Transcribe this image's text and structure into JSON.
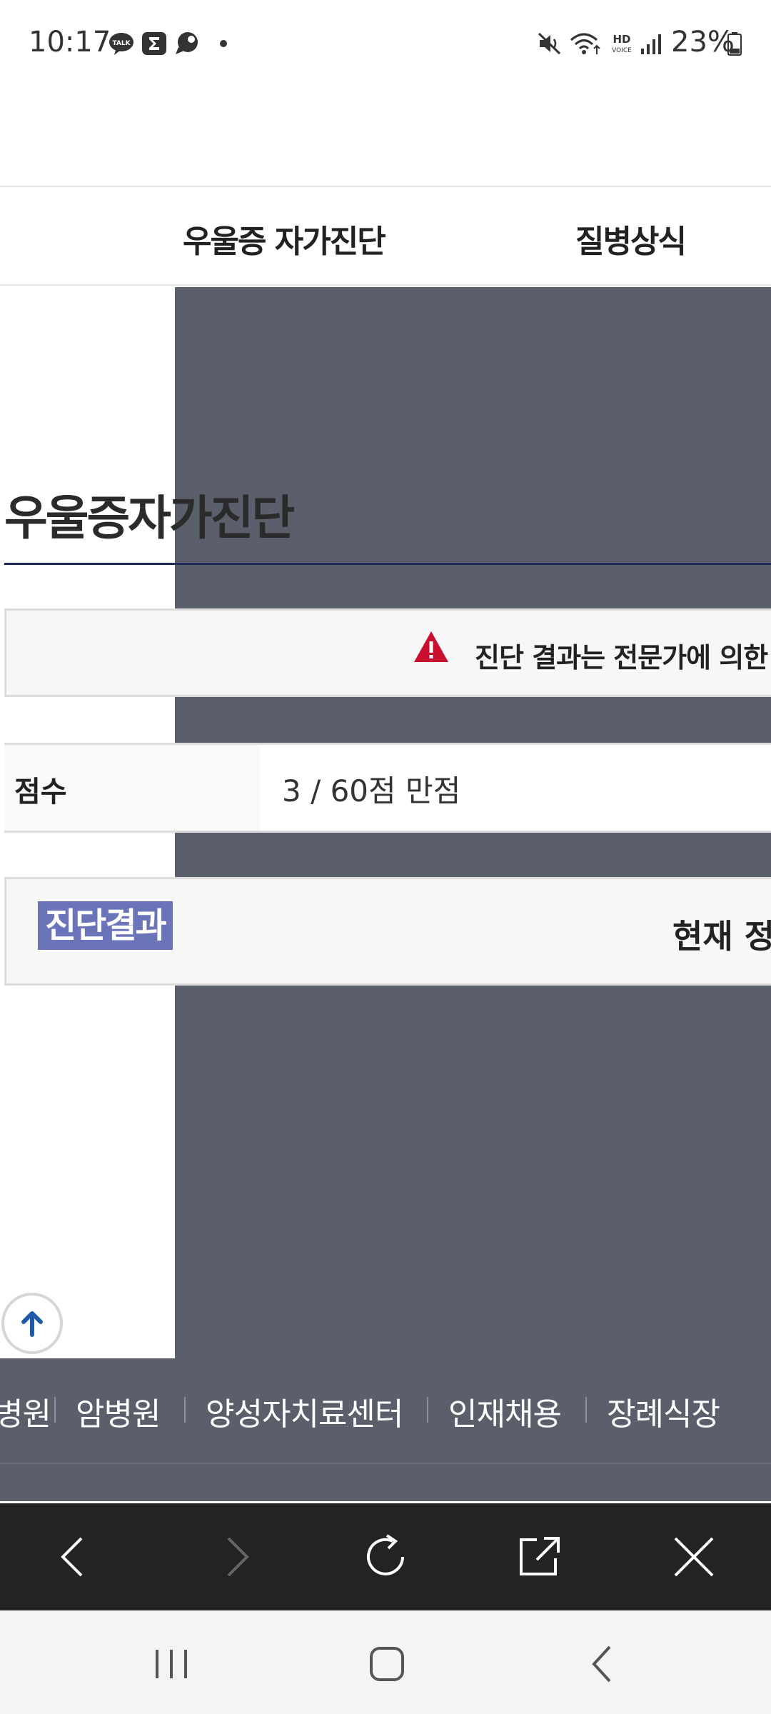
{
  "status_bar": {
    "time": "10:17",
    "battery_percent": "23%",
    "icons": [
      "kakaotalk-icon",
      "sigma-app-icon",
      "chat-bubble-icon",
      "dot-icon",
      "mute-icon",
      "wifi-icon",
      "hd-voice-icon",
      "signal-icon",
      "battery-icon"
    ]
  },
  "nav": {
    "items": [
      {
        "label": "우울증 자가진단"
      },
      {
        "label": "질병상식"
      }
    ]
  },
  "main": {
    "page_title": "우울증자가진단",
    "notice_text": "진단 결과는 전문가에 의한",
    "score_label": "점수",
    "score_value": "3 / 60점 만점",
    "result_label": "진단결과",
    "result_current": "현재 정"
  },
  "footer": {
    "links": [
      {
        "label": "병원"
      },
      {
        "label": "암병원"
      },
      {
        "label": "양성자치료센터"
      },
      {
        "label": "인재채용"
      },
      {
        "label": "장례식장"
      }
    ]
  },
  "colors": {
    "overlay": "#5a5f6b",
    "accent_underline": "#1d2a5a",
    "result_highlight": "#6b74b8",
    "warning": "#c8102e",
    "browser_bar": "#232323"
  }
}
